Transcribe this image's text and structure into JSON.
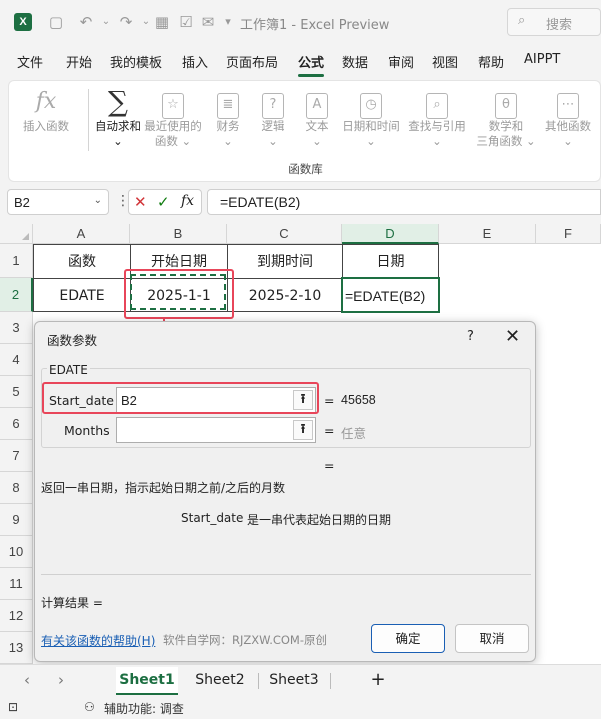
{
  "title": {
    "app_title": "工作簿1 - Excel Preview",
    "search_placeholder": "搜索"
  },
  "menu": [
    "文件",
    "开始",
    "我的模板",
    "插入",
    "页面布局",
    "公式",
    "数据",
    "审阅",
    "视图",
    "帮助",
    "AIPPT"
  ],
  "ribbon": {
    "buttons": [
      {
        "label": "插入函数",
        "label2": ""
      },
      {
        "label": "自动求和",
        "label2": "⌄"
      },
      {
        "label": "最近使用的",
        "label2": "函数 ⌄"
      },
      {
        "label": "财务",
        "label2": "⌄"
      },
      {
        "label": "逻辑",
        "label2": "⌄"
      },
      {
        "label": "文本",
        "label2": "⌄"
      },
      {
        "label": "日期和时间",
        "label2": "⌄"
      },
      {
        "label": "查找与引用",
        "label2": "⌄"
      },
      {
        "label": "数学和",
        "label2": "三角函数 ⌄"
      },
      {
        "label": "其他函数",
        "label2": "⌄"
      }
    ],
    "group_label": "函数库"
  },
  "formula_bar": {
    "name_box": "B2",
    "formula": "=EDATE(B2)"
  },
  "grid": {
    "columns": [
      "A",
      "B",
      "C",
      "D",
      "E",
      "F"
    ],
    "rows": [
      "1",
      "2",
      "3",
      "4",
      "5",
      "6",
      "7",
      "8",
      "9",
      "10",
      "11",
      "12",
      "13"
    ],
    "cells": {
      "A1": "函数",
      "B1": "开始日期",
      "C1": "到期时间",
      "D1": "日期",
      "A2": "EDATE",
      "B2": "2025-1-1",
      "C2": "2025-2-10",
      "D2": "=EDATE(B2)"
    }
  },
  "dialog": {
    "title": "函数参数",
    "help": "?",
    "function_name": "EDATE",
    "args": [
      {
        "label": "Start_date",
        "value": "B2",
        "result": "45658"
      },
      {
        "label": "Months",
        "value": "",
        "result": "任意"
      }
    ],
    "equals": "=",
    "description": "返回一串日期，指示起始日期之前/之后的月数",
    "arg_name": "Start_date",
    "arg_desc": "是一串代表起始日期的日期",
    "result_label": "计算结果 =",
    "help_link": "有关该函数的帮助(H)",
    "watermark": "软件自学网：RJZXW.COM-原创",
    "ok": "确定",
    "cancel": "取消"
  },
  "sheets": [
    "Sheet1",
    "Sheet2",
    "Sheet3"
  ],
  "add_sheet": "+",
  "status": {
    "accessibility": "辅助功能: 调查"
  },
  "colors": {
    "accent": "#1d6f42",
    "annotation": "#e8465a"
  }
}
